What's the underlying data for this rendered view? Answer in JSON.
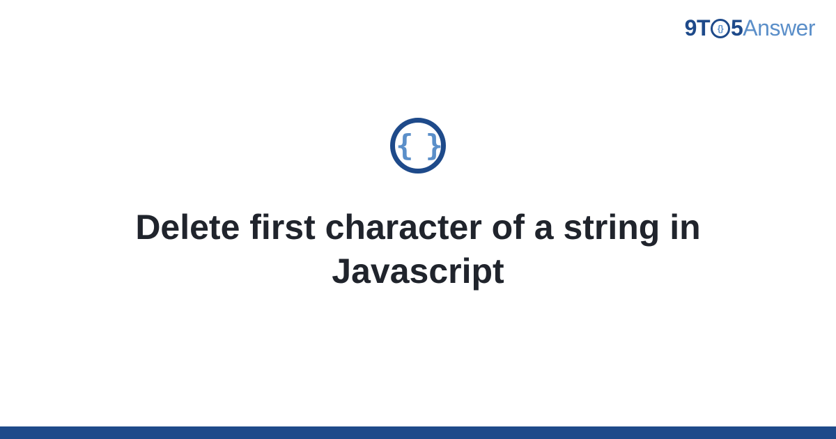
{
  "logo": {
    "part1": "9T",
    "part_o_inner": "{}",
    "part2": "5",
    "part3": "Answer"
  },
  "icon": {
    "name": "code-braces-icon",
    "glyph": "{ }"
  },
  "title": "Delete first character of a string in Javascript",
  "colors": {
    "primary_dark": "#1e4a8a",
    "primary_light": "#5b8fc9",
    "text": "#20242c",
    "background": "#ffffff"
  }
}
